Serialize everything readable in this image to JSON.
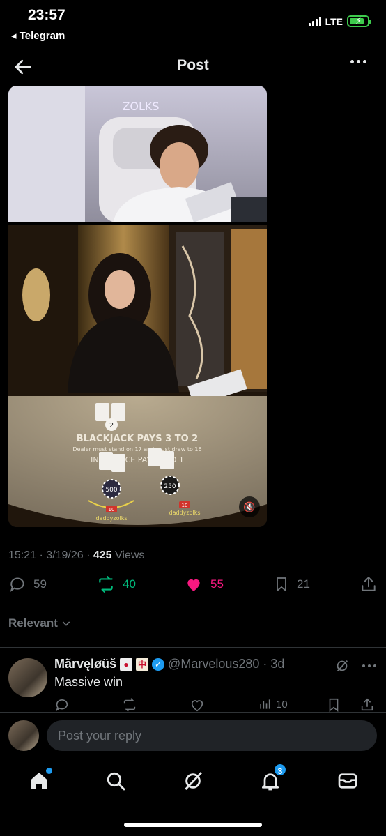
{
  "status_bar": {
    "time": "23:57",
    "back_app": "◂ Telegram",
    "network": "LTE"
  },
  "header": {
    "title": "Post"
  },
  "media": {
    "neon_sign": "ZOLKS",
    "table_text_line1": "BLACKJACK PAYS 3 TO 2",
    "table_text_line2": "Dealer must stand on 17 and must draw to 16",
    "table_text_line3": "INSURANCE PAYS 2 TO 1",
    "hand_total": "2",
    "chip_left": "500",
    "chip_right": "250",
    "chip_small_left": "10",
    "chip_small_right": "10",
    "player_left": "daddyzolks",
    "player_right": "daddyzolks"
  },
  "meta": {
    "time_date": "15:21 · 3/19/26 · ",
    "views_count": "425",
    "views_label": " Views"
  },
  "actions": {
    "replies": "59",
    "reposts": "40",
    "likes": "55",
    "bookmarks": "21"
  },
  "colors": {
    "accent": "#1d9bf0",
    "repost": "#00ba7c",
    "like": "#f91880",
    "muted": "#71767b"
  },
  "sort": {
    "label": "Relevant"
  },
  "reply": {
    "name": "Mãrvęløüš",
    "handle": "@Marvelous280",
    "time": "· 3d",
    "text": "Massive win",
    "views": "10"
  },
  "compose": {
    "placeholder": "Post your reply"
  },
  "tabbar": {
    "notifications_badge": "3"
  }
}
